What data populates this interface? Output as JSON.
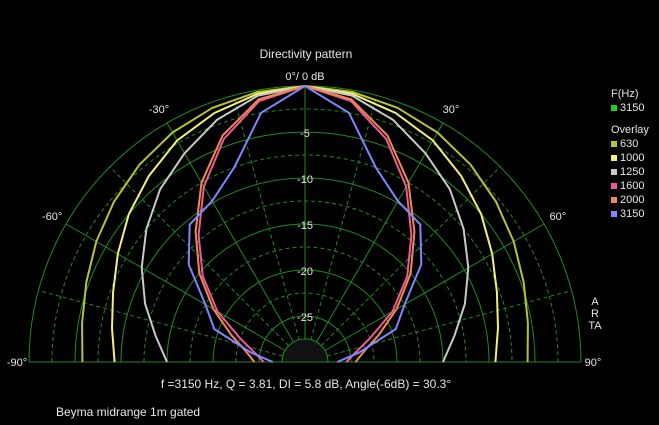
{
  "chart_data": {
    "type": "polar",
    "title": "Directivity pattern",
    "subtitle": "Beyma midrange 1m gated",
    "summary": "f =3150 Hz,  Q =  3.81,  DI =   5.8 dB,  Angle(-6dB) =  30.3°",
    "watermark": "ARTA",
    "radial_ticks": [
      "0°/ 0 dB",
      "-5",
      "-10",
      "-15",
      "-20",
      "-25"
    ],
    "radial_values": [
      0,
      -5,
      -10,
      -15,
      -20,
      -25
    ],
    "angle_ticks": [
      {
        "angle": -90,
        "label": "-90°"
      },
      {
        "angle": -60,
        "label": "-60°"
      },
      {
        "angle": -30,
        "label": "-30°"
      },
      {
        "angle": 30,
        "label": "30°"
      },
      {
        "angle": 60,
        "label": "60°"
      },
      {
        "angle": 90,
        "label": "90°"
      }
    ],
    "rlim": [
      -30,
      0
    ],
    "grid": true,
    "legend": {
      "current_title": "F(Hz)",
      "current": [
        {
          "name": "3150",
          "color": "#22d022"
        }
      ],
      "overlay_title": "Overlay",
      "overlay": [
        {
          "name": "630",
          "color": "#b7c234"
        },
        {
          "name": "1000",
          "color": "#f3f07a"
        },
        {
          "name": "1250",
          "color": "#c9c9c9"
        },
        {
          "name": "1600",
          "color": "#f05a9d"
        },
        {
          "name": "2000",
          "color": "#f08a4a"
        },
        {
          "name": "3150",
          "color": "#7f86ff"
        }
      ]
    },
    "angles": [
      0,
      10,
      20,
      30,
      40,
      50,
      60,
      70,
      80,
      90
    ],
    "series": [
      {
        "name": "630",
        "color": "#b7c234",
        "values": [
          0,
          -0.2,
          -0.6,
          -1.2,
          -2.0,
          -2.9,
          -3.8,
          -4.7,
          -5.4,
          -5.8
        ]
      },
      {
        "name": "1000",
        "color": "#f3f07a",
        "values": [
          0,
          -0.4,
          -1.2,
          -2.2,
          -3.6,
          -5.0,
          -6.5,
          -7.8,
          -8.7,
          -9.3
        ]
      },
      {
        "name": "1250",
        "color": "#c9c9c9",
        "values": [
          0,
          -0.6,
          -2.0,
          -3.8,
          -5.5,
          -7.5,
          -9.5,
          -11.5,
          -13.5,
          -15.0
        ]
      },
      {
        "name": "1600",
        "color": "#f05a9d",
        "values": [
          0,
          -1.2,
          -4.2,
          -8.0,
          -12.0,
          -15.5,
          -19.0,
          -22.5,
          -24.5,
          -25.5
        ]
      },
      {
        "name": "2000",
        "color": "#f08a4a",
        "values": [
          0,
          -1.0,
          -3.8,
          -7.5,
          -11.5,
          -15.0,
          -18.5,
          -21.5,
          -23.5,
          -24.5
        ]
      },
      {
        "name": "3150",
        "color": "#7f86ff",
        "values": [
          0,
          -2.5,
          -7.5,
          -9.8,
          -10.5,
          -13.5,
          -17.5,
          -19.5,
          -24.0,
          -26.5
        ]
      }
    ]
  }
}
